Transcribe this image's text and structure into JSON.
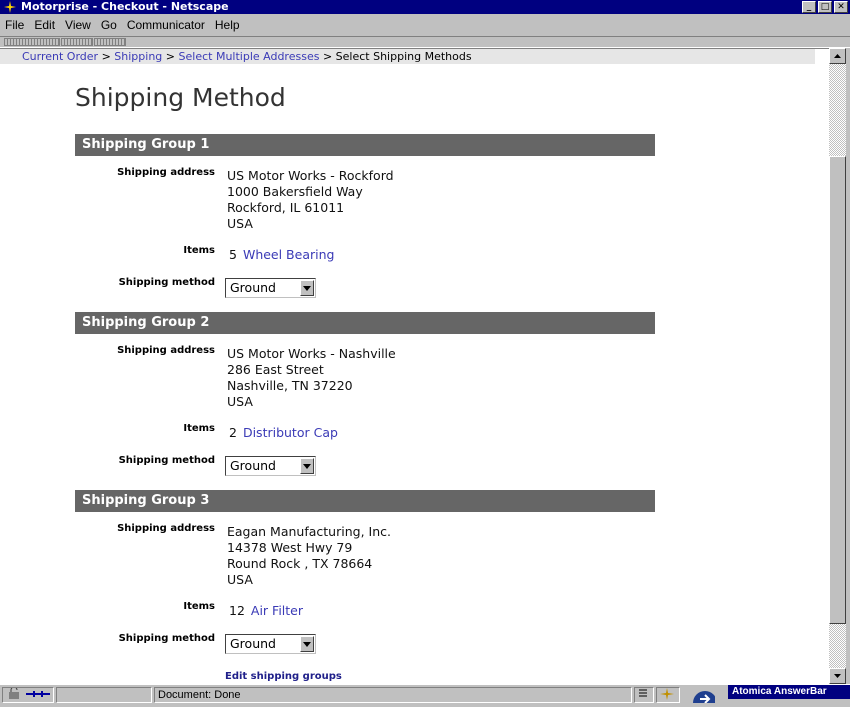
{
  "window": {
    "title": "Motorprise - Checkout - Netscape"
  },
  "menu": {
    "file": "File",
    "edit": "Edit",
    "view": "View",
    "go": "Go",
    "communicator": "Communicator",
    "help": "Help"
  },
  "breadcrumb": {
    "current_order": "Current Order",
    "shipping": "Shipping",
    "select_multiple": "Select Multiple Addresses",
    "current": "Select Shipping Methods",
    "sep": ">"
  },
  "page_title": "Shipping Method",
  "labels": {
    "address": "Shipping address",
    "items": "Items",
    "method": "Shipping method"
  },
  "groups": [
    {
      "header": "Shipping Group 1",
      "address": [
        "US Motor Works - Rockford",
        "1000 Bakersfield Way",
        "Rockford, IL 61011",
        "USA"
      ],
      "qty": "5",
      "item": "Wheel Bearing",
      "method": "Ground"
    },
    {
      "header": "Shipping Group 2",
      "address": [
        "US Motor Works - Nashville",
        "286 East Street",
        "Nashville, TN 37220",
        "USA"
      ],
      "qty": "2",
      "item": "Distributor Cap",
      "method": "Ground"
    },
    {
      "header": "Shipping Group 3",
      "address": [
        "Eagan Manufacturing, Inc.",
        "14378 West Hwy 79",
        "Round Rock , TX 78664",
        "USA"
      ],
      "qty": "12",
      "item": "Air Filter",
      "method": "Ground"
    }
  ],
  "edit_link": "Edit shipping groups",
  "status": {
    "text": "Document: Done",
    "answerbar": "Atomica AnswerBar"
  },
  "colors": {
    "title_bar": "#000080",
    "group_header": "#666666",
    "link": "#3a3ab6"
  }
}
